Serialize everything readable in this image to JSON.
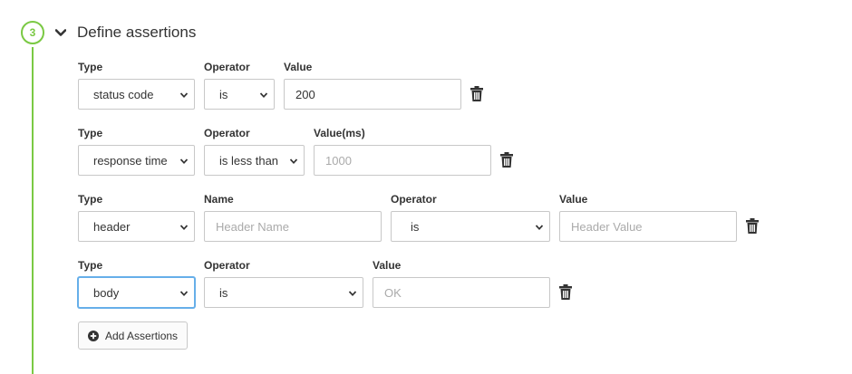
{
  "step": {
    "number": "3",
    "title": "Define assertions"
  },
  "assertions": [
    {
      "type": {
        "label": "Type",
        "value": "status code"
      },
      "operator": {
        "label": "Operator",
        "value": "is"
      },
      "value": {
        "label": "Value",
        "value": "200",
        "placeholder": ""
      }
    },
    {
      "type": {
        "label": "Type",
        "value": "response time"
      },
      "operator": {
        "label": "Operator",
        "value": "is less than"
      },
      "value": {
        "label": "Value(ms)",
        "value": "",
        "placeholder": "1000"
      }
    },
    {
      "type": {
        "label": "Type",
        "value": "header"
      },
      "name": {
        "label": "Name",
        "value": "",
        "placeholder": "Header Name"
      },
      "operator": {
        "label": "Operator",
        "value": "is"
      },
      "value": {
        "label": "Value",
        "value": "",
        "placeholder": "Header Value"
      }
    },
    {
      "type": {
        "label": "Type",
        "value": "body"
      },
      "operator": {
        "label": "Operator",
        "value": "is"
      },
      "value": {
        "label": "Value",
        "value": "",
        "placeholder": "OK"
      }
    }
  ],
  "add_button": {
    "label": "Add Assertions"
  },
  "colors": {
    "accent": "#7ac943",
    "focus": "#66afe9"
  },
  "icons": [
    "chevron-down-icon",
    "trash-icon",
    "plus-circle-icon",
    "caret-down-icon"
  ]
}
